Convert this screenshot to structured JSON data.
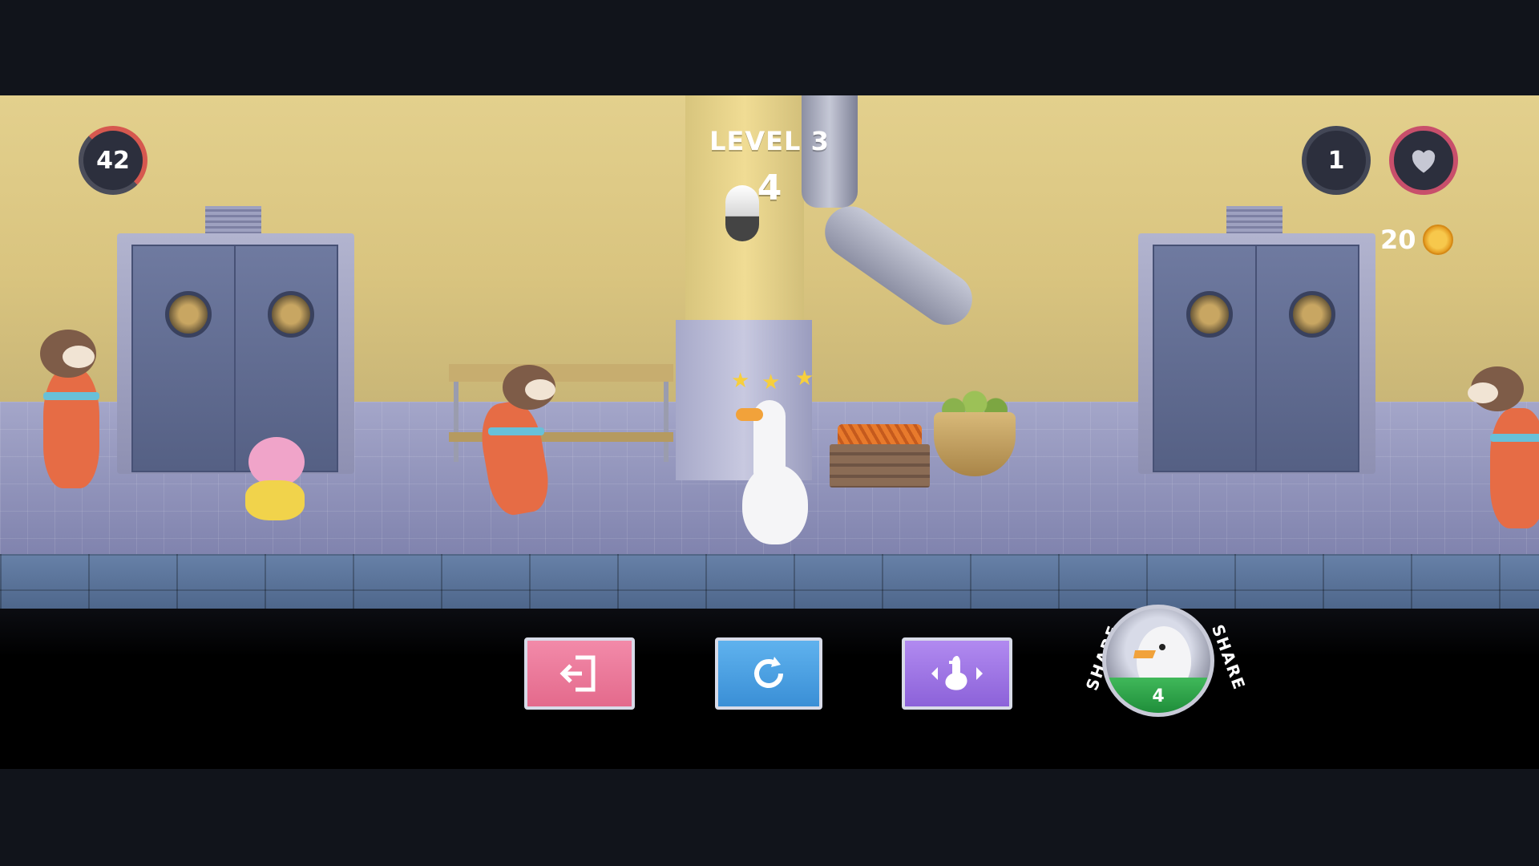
{
  "hud": {
    "timer": "42",
    "level_label": "LEVEL 3",
    "level_counter": "4",
    "lives": "1",
    "heart_icon": "heart-icon",
    "coins": "20",
    "coin_icon": "coin-icon"
  },
  "scene": {
    "characters": [
      "ferret",
      "pig",
      "ferret",
      "goose",
      "ferret"
    ],
    "objects": [
      "double-door",
      "prep-table",
      "carrot-crate",
      "lime-basket",
      "double-door"
    ]
  },
  "controls": {
    "exit_icon": "exit-icon",
    "restart_icon": "restart-icon",
    "controls_icon": "goose-arrows-icon",
    "share_left_label": "SHARE",
    "share_right_label": "SHARE",
    "share_count": "4"
  },
  "colors": {
    "exit_button": "#e97196",
    "restart_button": "#449adf",
    "controls_button": "#9a72e2",
    "share_green": "#2ea24a"
  }
}
